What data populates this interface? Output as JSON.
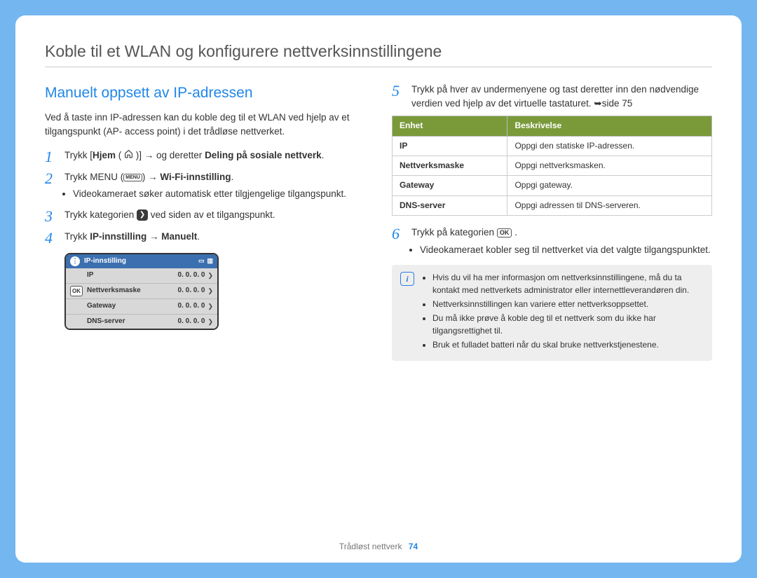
{
  "doc_title": "Koble til et WLAN og konfigurere nettverksinnstillingene",
  "section_title": "Manuelt oppsett av IP-adressen",
  "intro": "Ved å taste inn IP-adressen kan du koble deg til et WLAN ved hjelp av et tilgangspunkt (AP- access point) i det trådløse nettverket.",
  "step1": {
    "pre": "Trykk [",
    "hjem": "Hjem",
    "mid": " ( ",
    "post_icon": " )] → og deretter ",
    "deling": "Deling på sosiale nettverk",
    "end": "."
  },
  "step2": {
    "pre": "Trykk MENU (",
    "menu_label": "MENU",
    "mid": ") → ",
    "wifi": "Wi-Fi-innstilling",
    "end": ".",
    "bullet": "Videokameraet søker automatisk etter tilgjengelige tilgangspunkt."
  },
  "step3": {
    "pre": "Trykk kategorien ",
    "post": " ved siden av et tilgangspunkt."
  },
  "step4": {
    "pre": "Trykk ",
    "ip": "IP-innstilling",
    "arrow": " → ",
    "manuelt": "Manuelt",
    "end": "."
  },
  "graphic": {
    "title": "IP-innstilling",
    "rows": [
      {
        "label": "IP",
        "value": "0. 0. 0. 0",
        "ok": false
      },
      {
        "label": "Nettverksmaske",
        "value": "0. 0. 0. 0",
        "ok": true
      },
      {
        "label": "Gateway",
        "value": "0. 0. 0. 0",
        "ok": false
      },
      {
        "label": "DNS-server",
        "value": "0. 0. 0. 0",
        "ok": false
      }
    ]
  },
  "step5": {
    "text": "Trykk på hver av undermenyene og tast deretter inn den nødvendige verdien ved hjelp av det virtuelle tastaturet. ➥side 75"
  },
  "table": {
    "head_unit": "Enhet",
    "head_desc": "Beskrivelse",
    "rows": [
      {
        "unit": "IP",
        "desc": "Oppgi den statiske IP-adressen."
      },
      {
        "unit": "Nettverksmaske",
        "desc": "Oppgi nettverksmasken."
      },
      {
        "unit": "Gateway",
        "desc": "Oppgi gateway."
      },
      {
        "unit": "DNS-server",
        "desc": "Oppgi adressen til DNS-serveren."
      }
    ]
  },
  "step6": {
    "pre": "Trykk på kategorien ",
    "ok_label": "OK",
    "end": " .",
    "bullet": "Videokameraet kobler seg til nettverket via det valgte tilgangspunktet."
  },
  "notes": [
    "Hvis du vil ha mer informasjon om nettverksinnstillingene, må du ta kontakt med nettverkets administrator eller internettleverandøren din.",
    "Nettverksinnstillingen kan variere etter nettverksoppsettet.",
    "Du må ikke prøve å koble deg til et nettverk som du ikke har tilgangsrettighet til.",
    "Bruk et fulladet batteri når du skal bruke nettverkstjenestene."
  ],
  "footer": {
    "section": "Trådløst nettverk",
    "page": "74"
  }
}
